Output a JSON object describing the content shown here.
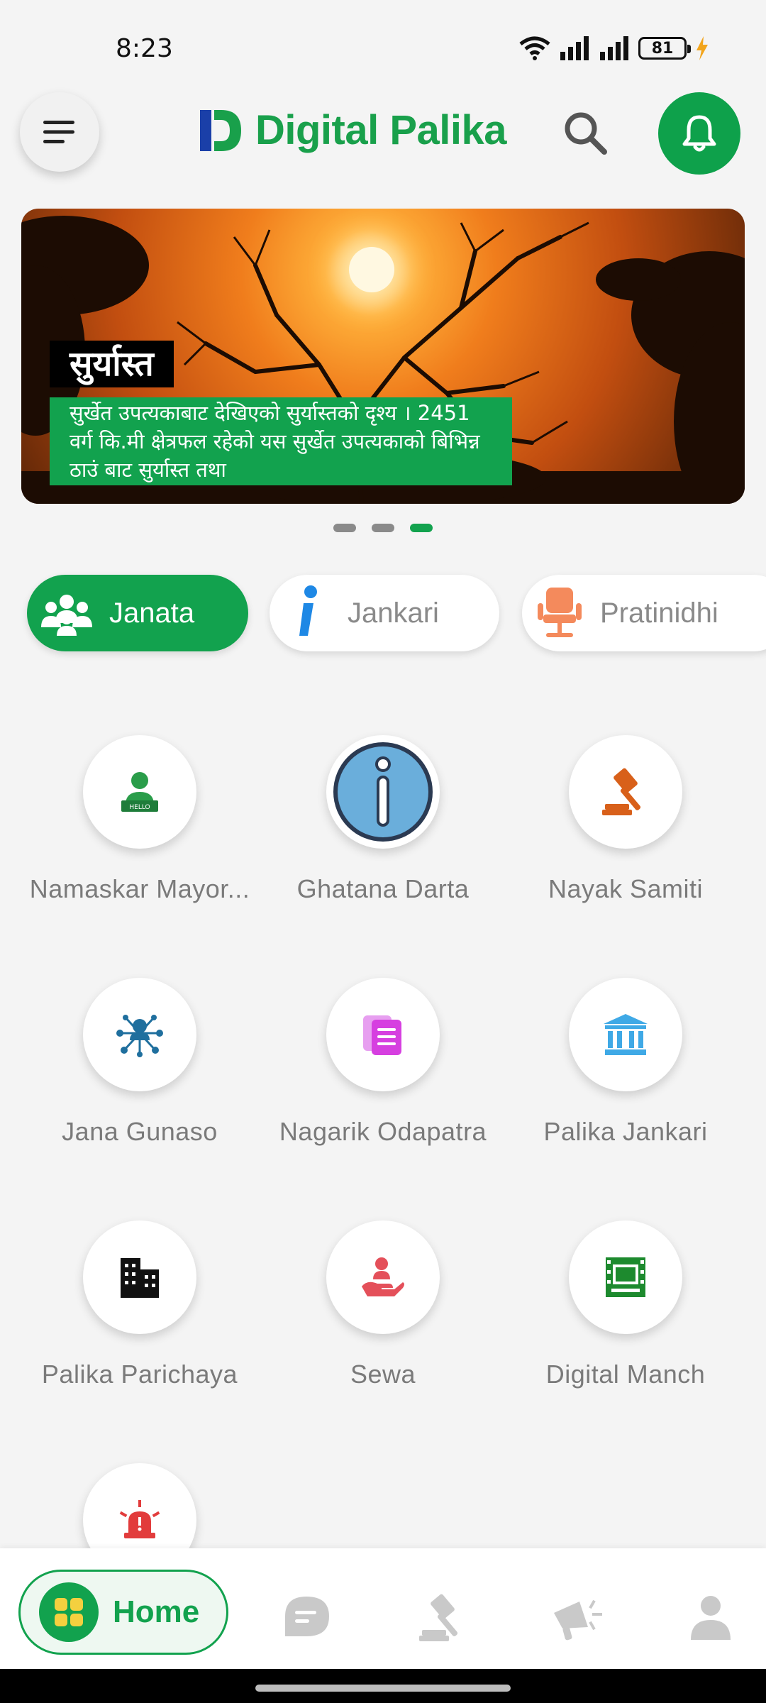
{
  "status_bar": {
    "time": "8:23",
    "battery": "81"
  },
  "header": {
    "app_name": "Digital Palika"
  },
  "banner": {
    "title": "सुर्यास्त",
    "description": "सुर्खेत उपत्यकाबाट देखिएको सुर्यास्तको दृश्य । 2451 वर्ग कि.मी क्षेत्रफल रहेको यस सुर्खेत उपत्यकाको बिभिन्न ठाउं बाट सुर्यास्त तथा",
    "slide_count": 3,
    "active_slide": 3
  },
  "tabs": [
    {
      "label": "Janata",
      "icon": "people-icon",
      "active": true
    },
    {
      "label": "Jankari",
      "icon": "info-icon",
      "active": false
    },
    {
      "label": "Pratinidhi",
      "icon": "chair-icon",
      "active": false
    }
  ],
  "services": [
    {
      "label": "Namaskar Mayor...",
      "icon": "hello-person-icon"
    },
    {
      "label": "Ghatana Darta",
      "icon": "info-circle-icon"
    },
    {
      "label": "Nayak Samiti",
      "icon": "gavel-icon"
    },
    {
      "label": "Jana Gunaso",
      "icon": "network-person-icon"
    },
    {
      "label": "Nagarik Odapatra",
      "icon": "documents-icon"
    },
    {
      "label": "Palika Jankari",
      "icon": "institution-icon"
    },
    {
      "label": "Palika Parichaya",
      "icon": "buildings-icon"
    },
    {
      "label": "Sewa",
      "icon": "helping-hand-icon"
    },
    {
      "label": "Digital Manch",
      "icon": "stage-icon"
    },
    {
      "label": "",
      "icon": "alarm-siren-icon"
    }
  ],
  "bottom_nav": {
    "home_label": "Home",
    "items": [
      "home-icon",
      "chat-icon",
      "gavel-icon",
      "megaphone-icon",
      "profile-icon"
    ]
  },
  "colors": {
    "primary_green": "#12a24e",
    "logo_blue": "#1a3fa8",
    "muted_text": "#7a7a7a"
  }
}
